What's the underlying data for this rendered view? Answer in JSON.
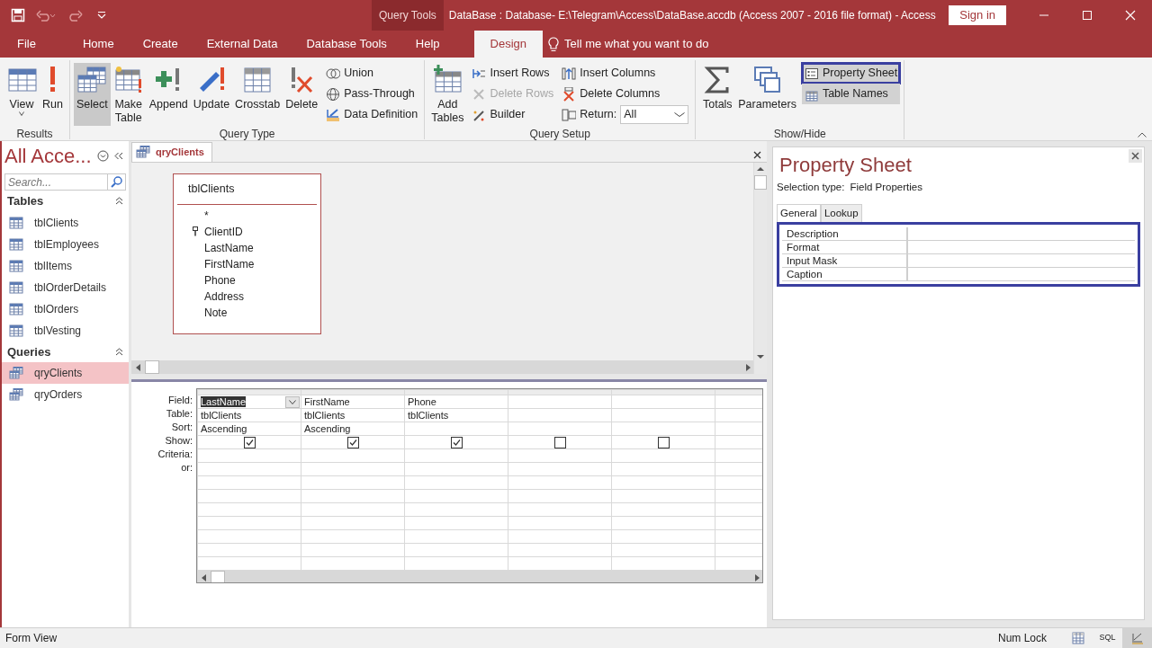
{
  "title_bar": {
    "context_label": "Query Tools",
    "title": "DataBase : Database- E:\\Telegram\\Access\\DataBase.accdb (Access 2007 - 2016 file format)  -  Access",
    "sign_in": "Sign in"
  },
  "ribbon_tabs": [
    {
      "label": "File",
      "selected": false
    },
    {
      "label": "Home",
      "selected": false
    },
    {
      "label": "Create",
      "selected": false
    },
    {
      "label": "External Data",
      "selected": false
    },
    {
      "label": "Database Tools",
      "selected": false
    },
    {
      "label": "Help",
      "selected": false
    },
    {
      "label": "Design",
      "selected": true
    }
  ],
  "tell_me": "Tell me what you want to do",
  "ribbon_groups": [
    {
      "label": "Results",
      "items": [
        {
          "kind": "large-menu",
          "label": "View",
          "selected": false
        },
        {
          "kind": "large",
          "label": "Run",
          "selected": false
        }
      ]
    },
    {
      "label": "Query Type",
      "items": [
        {
          "kind": "large",
          "label": "Select",
          "selected": true
        },
        {
          "kind": "large",
          "label": "Make Table",
          "selected": false
        },
        {
          "kind": "large",
          "label": "Append",
          "selected": false
        },
        {
          "kind": "large",
          "label": "Update",
          "selected": false
        },
        {
          "kind": "large",
          "label": "Crosstab",
          "selected": false
        },
        {
          "kind": "large",
          "label": "Delete",
          "selected": false
        },
        {
          "kind": "stack",
          "items": [
            {
              "kind": "small",
              "label": "Union",
              "disabled": false,
              "selected": false,
              "highlighted": false
            },
            {
              "kind": "small",
              "label": "Pass-Through",
              "disabled": false,
              "selected": false,
              "highlighted": false
            },
            {
              "kind": "small",
              "label": "Data Definition",
              "disabled": false,
              "selected": false,
              "highlighted": false
            }
          ]
        }
      ]
    },
    {
      "label": "Query Setup",
      "items": [
        {
          "kind": "large",
          "label": "Add Tables",
          "selected": false
        },
        {
          "kind": "stack",
          "items": [
            {
              "kind": "small",
              "label": "Insert Rows",
              "disabled": false,
              "selected": false,
              "highlighted": false
            },
            {
              "kind": "small",
              "label": "Delete Rows",
              "disabled": true,
              "selected": false,
              "highlighted": false
            },
            {
              "kind": "small",
              "label": "Builder",
              "disabled": false,
              "selected": false,
              "highlighted": false
            }
          ]
        },
        {
          "kind": "stack",
          "items": [
            {
              "kind": "small",
              "label": "Insert Columns",
              "disabled": false,
              "selected": false,
              "highlighted": false
            },
            {
              "kind": "small",
              "label": "Delete Columns",
              "disabled": false,
              "selected": false,
              "highlighted": false
            },
            {
              "kind": "dropdown",
              "label": "Return:",
              "value": "All"
            }
          ]
        }
      ]
    },
    {
      "label": "Show/Hide",
      "items": [
        {
          "kind": "large",
          "label": "Totals",
          "selected": false
        },
        {
          "kind": "large",
          "label": "Parameters",
          "selected": false
        },
        {
          "kind": "stack",
          "items": [
            {
              "kind": "small",
              "label": "Property Sheet",
              "disabled": false,
              "selected": true,
              "highlighted": true
            },
            {
              "kind": "small",
              "label": "Table Names",
              "disabled": false,
              "selected": true,
              "highlighted": false
            }
          ]
        }
      ]
    }
  ],
  "nav_pane": {
    "title": "All Acce...",
    "search": {
      "placeholder": "Search..."
    },
    "groups": [
      {
        "label": "Tables",
        "expanded": true,
        "items": [
          {
            "label": "tblClients",
            "selected": false
          },
          {
            "label": "tblEmployees",
            "selected": false
          },
          {
            "label": "tblItems",
            "selected": false
          },
          {
            "label": "tblOrderDetails",
            "selected": false
          },
          {
            "label": "tblOrders",
            "selected": false
          },
          {
            "label": "tblVesting",
            "selected": false
          }
        ]
      },
      {
        "label": "Queries",
        "expanded": true,
        "items": [
          {
            "label": "qryClients",
            "selected": true
          },
          {
            "label": "qryOrders",
            "selected": false
          }
        ]
      }
    ]
  },
  "query_window": {
    "tab": "qryClients",
    "table_box": {
      "title": "tblClients",
      "fields": [
        {
          "name": "*",
          "key": false
        },
        {
          "name": "ClientID",
          "key": true
        },
        {
          "name": "LastName",
          "key": false
        },
        {
          "name": "FirstName",
          "key": false
        },
        {
          "name": "Phone",
          "key": false
        },
        {
          "name": "Address",
          "key": false
        },
        {
          "name": "Note",
          "key": false
        }
      ]
    },
    "grid": {
      "row_labels": [
        "Field:",
        "Table:",
        "Sort:",
        "Show:",
        "Criteria:",
        "or:"
      ],
      "columns": [
        {
          "field": "LastName",
          "table": "tblClients",
          "sort": "Ascending",
          "show": true,
          "selected": true
        },
        {
          "field": "FirstName",
          "table": "tblClients",
          "sort": "Ascending",
          "show": true,
          "selected": false
        },
        {
          "field": "Phone",
          "table": "tblClients",
          "show": true,
          "selected": false
        },
        {
          "show": false,
          "selected": false
        },
        {
          "show": false,
          "selected": false
        },
        {
          "selected": false
        }
      ]
    }
  },
  "property_sheet": {
    "title": "Property Sheet",
    "selection_label": "Selection type:",
    "selection_type": "Field Properties",
    "tabs": [
      {
        "label": "General",
        "selected": true
      },
      {
        "label": "Lookup",
        "selected": false
      }
    ],
    "highlighted": true,
    "properties": [
      {
        "name": "Description"
      },
      {
        "name": "Format"
      },
      {
        "name": "Input Mask"
      },
      {
        "name": "Caption"
      }
    ]
  },
  "status_bar": {
    "left": "Form View",
    "num_lock": "Num Lock",
    "views": [
      {
        "kind": "icon",
        "selected": false
      },
      {
        "kind": "text",
        "label": "SQL",
        "selected": false
      },
      {
        "kind": "icon",
        "selected": true
      }
    ]
  }
}
